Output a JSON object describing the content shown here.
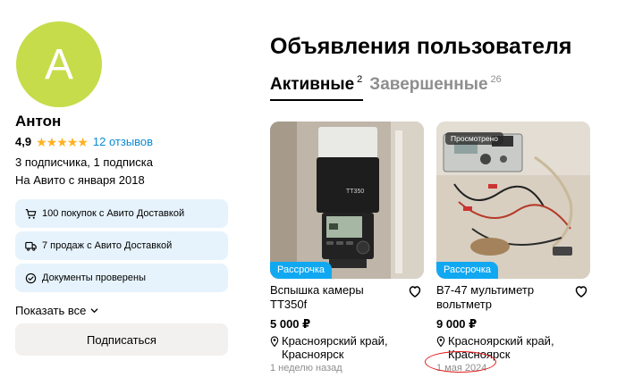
{
  "profile": {
    "avatar_letter": "A",
    "avatar_color": "#c6dc4a",
    "name": "Антон",
    "rating": "4,9",
    "stars": 5,
    "reviews_link": "12 отзывов",
    "subscriptions": "3 подписчика, 1 подписка",
    "since": "На Авито с января 2018"
  },
  "info_cards": [
    {
      "icon": "cart-icon",
      "text": "100 покупок с Авито Доставкой"
    },
    {
      "icon": "truck-icon",
      "text": "7 продаж с Авито Доставкой"
    },
    {
      "icon": "check-circle-icon",
      "text": "Документы проверены"
    }
  ],
  "show_all": "Показать все",
  "subscribe_button": "Подписаться",
  "main": {
    "title": "Объявления пользователя",
    "tabs": [
      {
        "label": "Активные",
        "count": "2",
        "active": true
      },
      {
        "label": "Завершенные",
        "count": "26",
        "active": false
      }
    ]
  },
  "listings": [
    {
      "title": "Вспышка камеры TT350f",
      "price": "5 000 ₽",
      "location": "Красноярский край, Красноярск",
      "date": "1 неделю назад",
      "badge": "Рассрочка",
      "viewed": ""
    },
    {
      "title": "В7-47 мультиметр вольтметр",
      "price": "9 000 ₽",
      "location": "Красноярский край, Красноярск",
      "date": "1 мая 2024",
      "badge": "Рассрочка",
      "viewed": "Просмотрено"
    }
  ],
  "colors": {
    "accent_blue": "#0a8bd3",
    "badge_blue": "#11a8f2",
    "star": "#ffb021",
    "info_bg": "#e6f3fc",
    "annotation_red": "#e21c1c"
  }
}
